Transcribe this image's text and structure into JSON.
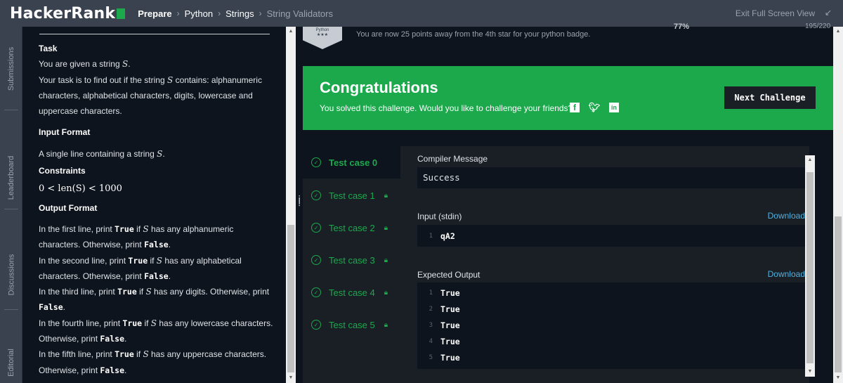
{
  "topbar": {
    "logo": "HackerRank",
    "breadcrumbs": [
      "Prepare",
      "Python",
      "Strings",
      "String Validators"
    ],
    "exit_label": "Exit Full Screen View"
  },
  "sidebar_tabs": [
    "Submissions",
    "Leaderboard",
    "Discussions",
    "Editorial"
  ],
  "problem": {
    "task_title": "Task",
    "task_line1": "You are given a string ",
    "var_s": "S",
    "task_line2a": "Your task is to find out if the string ",
    "task_line2b": " contains: alphanumeric characters, alphabetical characters, digits, lowercase and uppercase characters.",
    "input_title": "Input Format",
    "input_text": "A single line containing a string ",
    "constraints_title": "Constraints",
    "constraint": "0 < len(S) < 1000",
    "output_title": "Output Format",
    "true_word": "True",
    "false_word": "False",
    "out1a": "In the first line, print ",
    "out1b": " if ",
    "out1c": " has any alphanumeric characters. Otherwise, print ",
    "out2a": "In the second line, print ",
    "out2c": " has any alphabetical characters. Otherwise, print ",
    "out3a": "In the third line, print ",
    "out3c": " has any digits. Otherwise, print ",
    "out4a": "In the fourth line, print ",
    "out4c": " has any lowercase characters. Otherwise, print ",
    "out5a": "In the fifth line, print ",
    "out5c": " has any uppercase characters. Otherwise, print ",
    "period": "."
  },
  "badge": {
    "name": "Python",
    "stars": "★★★",
    "message": "You are now 25 points away from the 4th star for your python badge.",
    "percent": "77%",
    "points": "195/220"
  },
  "congrats": {
    "title": "Congratulations",
    "subtitle": "You solved this challenge. Would you like to challenge your friends?",
    "next_button": "Next Challenge"
  },
  "test_cases": [
    "Test case 0",
    "Test case 1",
    "Test case 2",
    "Test case 3",
    "Test case 4",
    "Test case 5"
  ],
  "output_panel": {
    "compiler_label": "Compiler Message",
    "compiler_value": "Success",
    "input_label": "Input (stdin)",
    "download_label": "Download",
    "input_lines": [
      "qA2"
    ],
    "expected_label": "Expected Output",
    "expected_lines": [
      "True",
      "True",
      "True",
      "True",
      "True"
    ]
  },
  "colors": {
    "accent_green": "#1ba94c",
    "topbar": "#39424e",
    "background": "#0e141e",
    "link_blue": "#4eb2e1"
  }
}
